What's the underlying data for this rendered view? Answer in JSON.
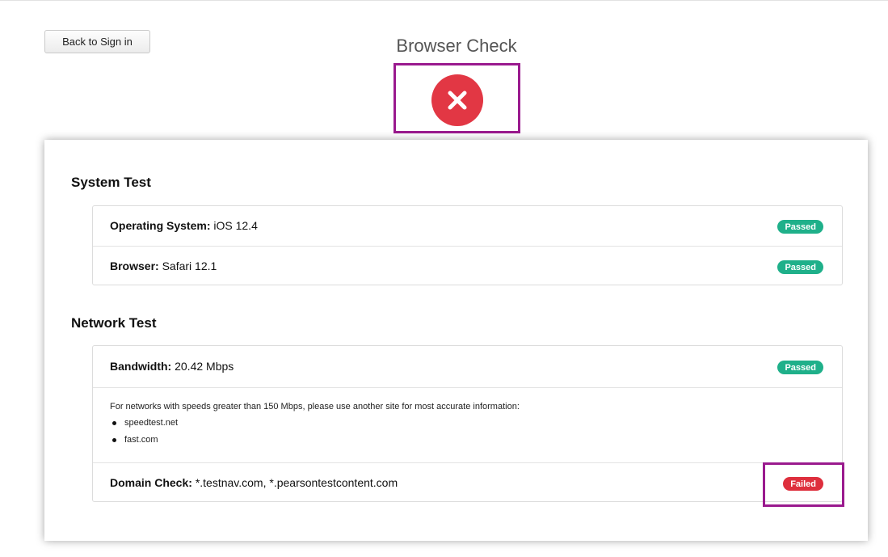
{
  "header": {
    "back_label": "Back to Sign in",
    "title": "Browser Check",
    "status_icon": "x-icon"
  },
  "system_test": {
    "title": "System Test",
    "rows": [
      {
        "label": "Operating System:",
        "value": "iOS 12.4",
        "status": "Passed"
      },
      {
        "label": "Browser:",
        "value": "Safari 12.1",
        "status": "Passed"
      }
    ]
  },
  "network_test": {
    "title": "Network Test",
    "bandwidth": {
      "label": "Bandwidth:",
      "value": "20.42 Mbps",
      "status": "Passed"
    },
    "note": "For networks with speeds greater than 150 Mbps, please use another site for most accurate information:",
    "links": [
      "speedtest.net",
      "fast.com"
    ],
    "domain_check": {
      "label": "Domain Check:",
      "value": "*.testnav.com, *.pearsontestcontent.com",
      "status": "Failed"
    }
  },
  "colors": {
    "passed": "#1fb08a",
    "failed": "#de2f3d",
    "highlight": "#9a1a8e"
  }
}
